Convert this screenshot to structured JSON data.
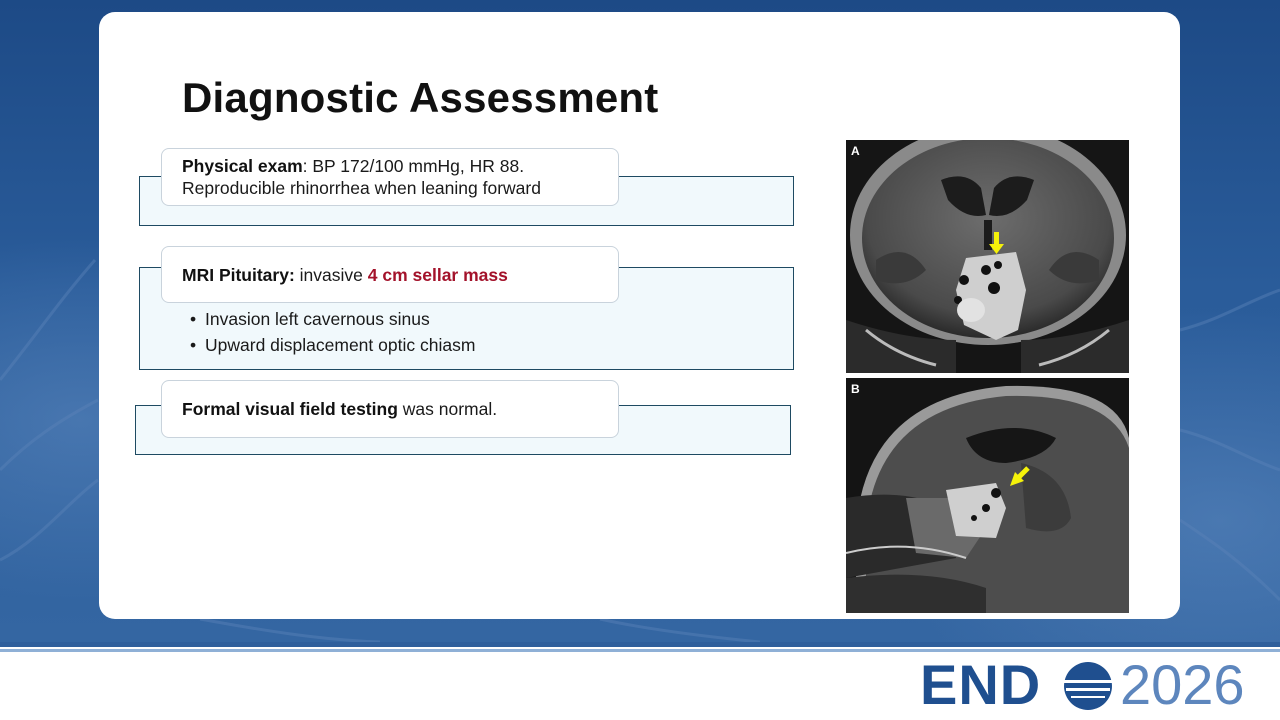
{
  "slide": {
    "title": "Diagnostic Assessment"
  },
  "cards": {
    "physical": {
      "label": "Physical exam",
      "text": ": BP 172/100 mmHg, HR 88.",
      "line2": "Reproducible rhinorrhea when leaning forward"
    },
    "mri": {
      "label": "MRI Pituitary:",
      "text": " invasive ",
      "highlight": "4 cm sellar mass",
      "bullets": [
        "Invasion left cavernous sinus",
        "Upward displacement optic chiasm"
      ]
    },
    "visual": {
      "label": "Formal visual field testing",
      "text": " was normal."
    }
  },
  "images": {
    "coronal_label": "A",
    "sagittal_label": "B"
  },
  "logo": {
    "end": "END",
    "year": "2026"
  },
  "colors": {
    "highlight": "#a3122a",
    "brand_blue": "#1f4f8f",
    "arrow_yellow": "#f5f20a"
  }
}
